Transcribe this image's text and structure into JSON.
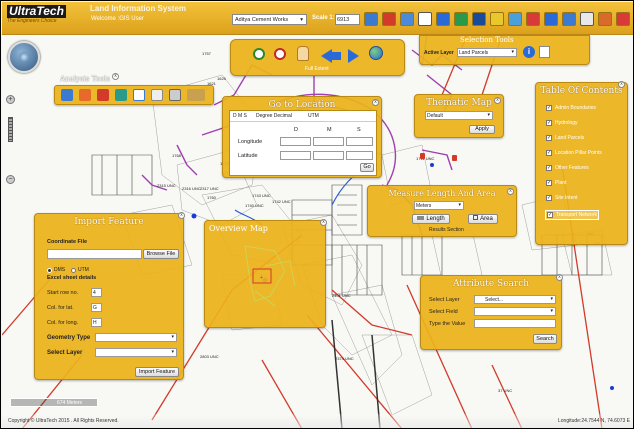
{
  "header": {
    "logo_main": "UltraTech",
    "logo_tagline": "The Engineers Choice",
    "app_title": "Land Information System",
    "welcome_text": "Welcome :GIS User",
    "company_select": "Aditya Cement Works",
    "scale_label": "Scale 1:",
    "scale_value": "6913"
  },
  "nav_tools": {
    "full_extent_label": "Full Extent"
  },
  "analysis_tools": {
    "title": "Analysis Tools"
  },
  "selection_tools": {
    "title": "Selection Tools",
    "active_layer_label": "Active Layer",
    "active_layer_value": "Land Parcels"
  },
  "go_to_location": {
    "title": "Go to Location",
    "tab_dms": "D M S",
    "tab_decimal": "Degree Decimal",
    "tab_utm": "UTM",
    "col_d": "D",
    "col_m": "M",
    "col_s": "S",
    "longitude_label": "Longitude",
    "latitude_label": "Latitude",
    "go_label": "Go"
  },
  "thematic_map": {
    "title": "Thematic Map",
    "select_value": "Default",
    "apply_label": "Apply"
  },
  "toc": {
    "title": "Table Of Contents",
    "items": [
      "Admin Boundaries",
      "Hydrology",
      "Land Parcels",
      "Location Pillar Points",
      "Other Features",
      "Plant",
      "Site Intent",
      "Transport Network"
    ]
  },
  "measure": {
    "title": "Measure Length And Area",
    "unit_value": "Meters",
    "length_label": "Length",
    "area_label": "Area",
    "results_label": "Results Section"
  },
  "import_feature": {
    "title": "Import Feature",
    "coordinate_file_label": "Coordinate File",
    "browse_label": "Browse File",
    "radio_dms": "DMS",
    "radio_utm": "UTM",
    "excel_details_label": "Excel sheet details",
    "start_row_label": "Start row no.",
    "start_row_value": "4",
    "col_lat_label": "Col. for lat.",
    "col_lat_value": "G",
    "col_long_label": "Col. for long.",
    "col_long_value": "H",
    "geometry_type_label": "Geometry Type",
    "select_layer_label": "Select Layer",
    "import_button": "Import Feature"
  },
  "overview_map": {
    "title": "Overview Map"
  },
  "attribute_search": {
    "title": "Attribute Search",
    "select_layer_label": "Select Layer",
    "select_layer_value": "Select...",
    "select_field_label": "Select Field",
    "type_value_label": "Type the Value",
    "search_label": "Search"
  },
  "status": {
    "scale_bar": "674 Meters",
    "copyright": "Copyright © UltraTech 2015 . All Rights Reserved.",
    "coordinates": "Longitude:24.7544 N, 74.6073 E"
  },
  "map_labels": [
    "2315 UNC",
    "2316 UNC",
    "2317 UNC",
    "1768",
    "1770 UNC",
    "1772 UNC",
    "1743 UNC",
    "1740 UNC",
    "1742 UNC",
    "1760",
    "2401 UNC",
    "2374 UNC",
    "2315",
    "2803 UNC",
    "37 UNC",
    "1711 UNC",
    "1620",
    "1621",
    "1625",
    "1713",
    "1714",
    "830",
    "631",
    "1757",
    "2410"
  ],
  "colors": {
    "panel_gold": "#ecb21a",
    "header_gold": "#e8b02a",
    "parcel_purple": "#a040b0",
    "road_red": "#d23a2a",
    "water_blue": "#2a5fd8"
  }
}
